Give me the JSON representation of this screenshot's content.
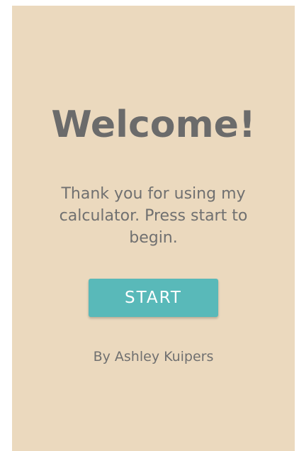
{
  "welcome": {
    "title": "Welcome!",
    "message": "Thank you for using my calculator. Press start to begin.",
    "start_label": "START",
    "byline": "By Ashley Kuipers"
  },
  "colors": {
    "background": "#ebd9be",
    "button": "#59b9b9",
    "text": "#6f6f6f"
  }
}
